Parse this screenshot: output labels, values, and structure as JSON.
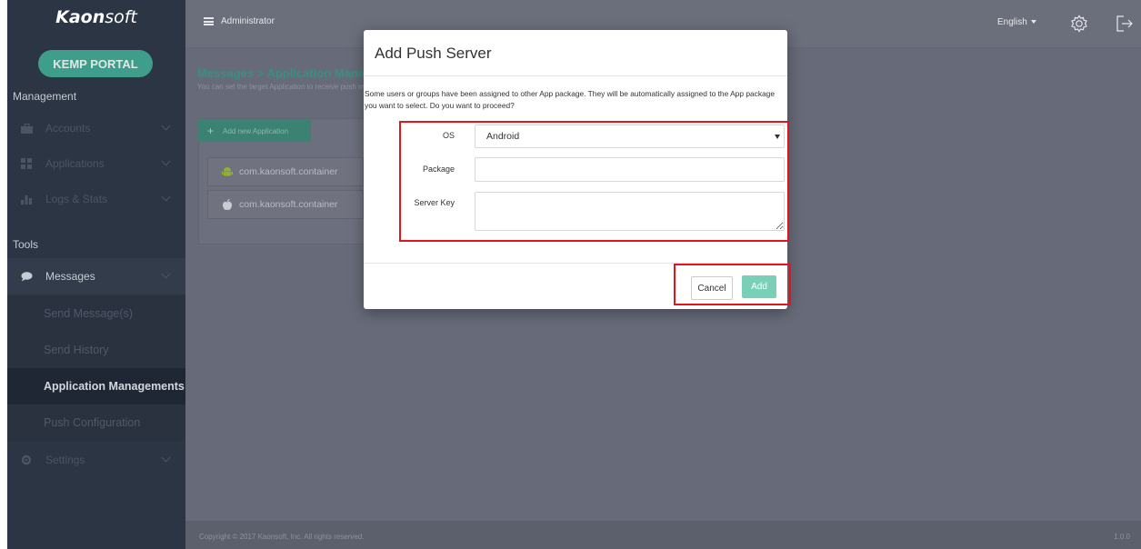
{
  "brand": {
    "logo_bold": "Kaon",
    "logo_light": "soft"
  },
  "sidebar": {
    "portal_button": "KEMP PORTAL",
    "section_management": "Management",
    "section_tools": "Tools",
    "items": [
      {
        "label": "Accounts",
        "icon": "briefcase-icon"
      },
      {
        "label": "Applications",
        "icon": "grid-icon"
      },
      {
        "label": "Logs & Stats",
        "icon": "bar-chart-icon"
      },
      {
        "label": "Messages",
        "icon": "chat-bubble-icon"
      },
      {
        "label": "Settings",
        "icon": "gear-icon"
      }
    ],
    "sub_items": [
      {
        "label": "Send Message(s)"
      },
      {
        "label": "Send History"
      },
      {
        "label": "Application Managements"
      },
      {
        "label": "Push Configuration"
      }
    ]
  },
  "topbar": {
    "user": "Administrator",
    "language": "English",
    "settings_icon": "gear-icon",
    "logout_icon": "logout-icon"
  },
  "main": {
    "breadcrumb": "Messages > Application Managements",
    "description": "You can set the target Application to receive push messages.",
    "add_button": "Add new Application",
    "apps": [
      {
        "name": "com.kaonsoft.container",
        "os_icon": "android-icon"
      },
      {
        "name": "com.kaonsoft.container",
        "os_icon": "apple-icon"
      }
    ]
  },
  "footer": {
    "copyright": "Copyright © 2017 Kaonsoft, Inc. All rights reserved.",
    "version": "1.0.0"
  },
  "modal": {
    "title": "Add Push Server",
    "message": "Some users or groups have been assigned to other App package. They will be automatically assigned to the App package you want to select. Do you want to proceed?",
    "os_label": "OS",
    "os_value": "Android",
    "package_label": "Package",
    "package_value": "",
    "server_key_label": "Server Key",
    "server_key_value": "",
    "cancel_label": "Cancel",
    "add_label": "Add"
  },
  "colors": {
    "accent": "#3f9e8b",
    "add_button": "#7ad0b7",
    "highlight": "#e3141b",
    "sidebar": "#2c3544"
  }
}
